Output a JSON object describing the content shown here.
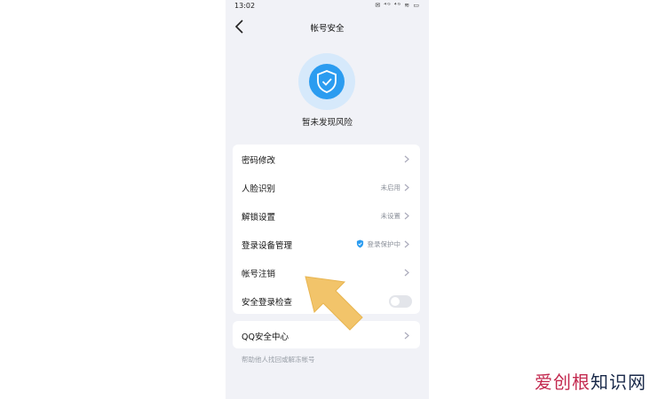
{
  "status_bar": {
    "time": "13:02",
    "icons": [
      "message-icon",
      "sim1-signal-icon",
      "sim2-signal-icon",
      "wifi-icon",
      "battery-icon"
    ],
    "icons_text": "✉ ⁴ᴳ ⁴ᴳ ≋ ▭"
  },
  "header": {
    "title": "帐号安全"
  },
  "security": {
    "status_text": "暂未发现风险",
    "accent": "#2b9cf0"
  },
  "menu": {
    "items": [
      {
        "label": "密码修改",
        "status": ""
      },
      {
        "label": "人脸识别",
        "status": "未启用"
      },
      {
        "label": "解锁设置",
        "status": "未设置"
      },
      {
        "label": "登录设备管理",
        "status": "登录保护中"
      },
      {
        "label": "帐号注销",
        "status": ""
      },
      {
        "label": "安全登录检查",
        "toggle": false
      }
    ]
  },
  "qq_center": {
    "label": "QQ安全中心"
  },
  "footer": {
    "text": "帮助他人找回或解冻帐号"
  },
  "watermark": {
    "brand_prefix": "爱",
    "brand_mid": "创根",
    "brand_suffix": "知识网"
  }
}
